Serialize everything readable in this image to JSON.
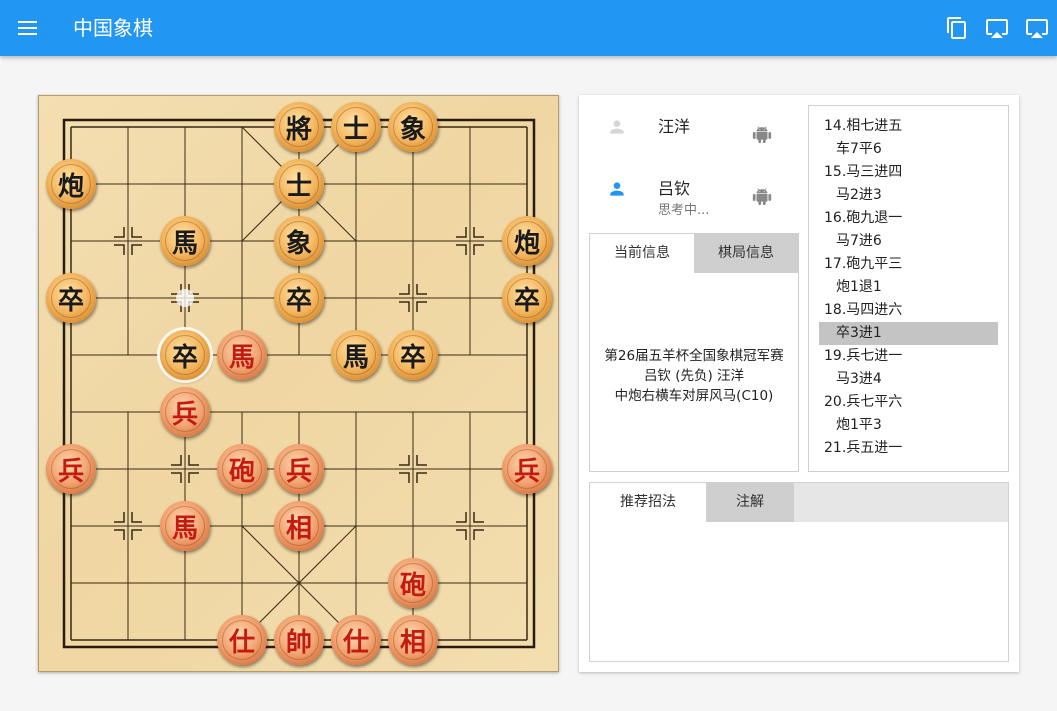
{
  "app": {
    "title": "中国象棋",
    "colors": {
      "appbar": "#2196f3",
      "red_piece_text": "#c41a10",
      "black_piece_text": "#1a1a1a"
    },
    "icons": [
      "menu-icon",
      "copy-icon",
      "cast-icon",
      "airplay-icon"
    ]
  },
  "board": {
    "pieces": [
      {
        "char": "將",
        "side": "black",
        "col": 4,
        "row": 0
      },
      {
        "char": "士",
        "side": "black",
        "col": 5,
        "row": 0
      },
      {
        "char": "象",
        "side": "black",
        "col": 6,
        "row": 0
      },
      {
        "char": "炮",
        "side": "black",
        "col": 0,
        "row": 1
      },
      {
        "char": "士",
        "side": "black",
        "col": 4,
        "row": 1
      },
      {
        "char": "馬",
        "side": "black",
        "col": 2,
        "row": 2
      },
      {
        "char": "象",
        "side": "black",
        "col": 4,
        "row": 2
      },
      {
        "char": "炮",
        "side": "black",
        "col": 8,
        "row": 2
      },
      {
        "char": "卒",
        "side": "black",
        "col": 0,
        "row": 3
      },
      {
        "char": "卒",
        "side": "black",
        "col": 4,
        "row": 3
      },
      {
        "char": "卒",
        "side": "black",
        "col": 8,
        "row": 3
      },
      {
        "char": "卒",
        "side": "black",
        "col": 2,
        "row": 4,
        "selected": true
      },
      {
        "char": "馬",
        "side": "red",
        "col": 3,
        "row": 4
      },
      {
        "char": "馬",
        "side": "black",
        "col": 5,
        "row": 4
      },
      {
        "char": "卒",
        "side": "black",
        "col": 6,
        "row": 4
      },
      {
        "char": "兵",
        "side": "red",
        "col": 2,
        "row": 5
      },
      {
        "char": "兵",
        "side": "red",
        "col": 0,
        "row": 6
      },
      {
        "char": "砲",
        "side": "red",
        "col": 3,
        "row": 6
      },
      {
        "char": "兵",
        "side": "red",
        "col": 4,
        "row": 6
      },
      {
        "char": "兵",
        "side": "red",
        "col": 8,
        "row": 6
      },
      {
        "char": "馬",
        "side": "red",
        "col": 2,
        "row": 7
      },
      {
        "char": "相",
        "side": "red",
        "col": 4,
        "row": 7
      },
      {
        "char": "砲",
        "side": "red",
        "col": 6,
        "row": 8
      },
      {
        "char": "仕",
        "side": "red",
        "col": 3,
        "row": 9
      },
      {
        "char": "帥",
        "side": "red",
        "col": 4,
        "row": 9
      },
      {
        "char": "仕",
        "side": "red",
        "col": 5,
        "row": 9
      },
      {
        "char": "相",
        "side": "red",
        "col": 6,
        "row": 9
      }
    ],
    "last_move_origin": {
      "col": 2,
      "row": 3
    }
  },
  "players": {
    "top": {
      "name": "汪洋",
      "status": ""
    },
    "bottom": {
      "name": "吕钦",
      "status": "思考中..."
    }
  },
  "info_tabs": {
    "current": "当前信息",
    "game": "棋局信息",
    "lines": [
      "第26届五羊杯全国象棋冠军赛",
      "吕钦 (先负) 汪洋",
      "中炮右横车对屏风马(C10)"
    ]
  },
  "moves": [
    {
      "text": "14.相七进五",
      "side": "red"
    },
    {
      "text": "车7平6",
      "side": "black"
    },
    {
      "text": "15.马三进四",
      "side": "red"
    },
    {
      "text": "马2进3",
      "side": "black"
    },
    {
      "text": "16.砲九退一",
      "side": "red"
    },
    {
      "text": "马7进6",
      "side": "black"
    },
    {
      "text": "17.砲九平三",
      "side": "red"
    },
    {
      "text": "炮1退1",
      "side": "black"
    },
    {
      "text": "18.马四进六",
      "side": "red"
    },
    {
      "text": "卒3进1",
      "side": "black",
      "selected": true
    },
    {
      "text": "19.兵七进一",
      "side": "red"
    },
    {
      "text": "马3进4",
      "side": "black"
    },
    {
      "text": "20.兵七平六",
      "side": "red"
    },
    {
      "text": "炮1平3",
      "side": "black"
    },
    {
      "text": "21.兵五进一",
      "side": "red"
    }
  ],
  "bottom_tabs": {
    "recommend": "推荐招法",
    "notes": "注解"
  }
}
